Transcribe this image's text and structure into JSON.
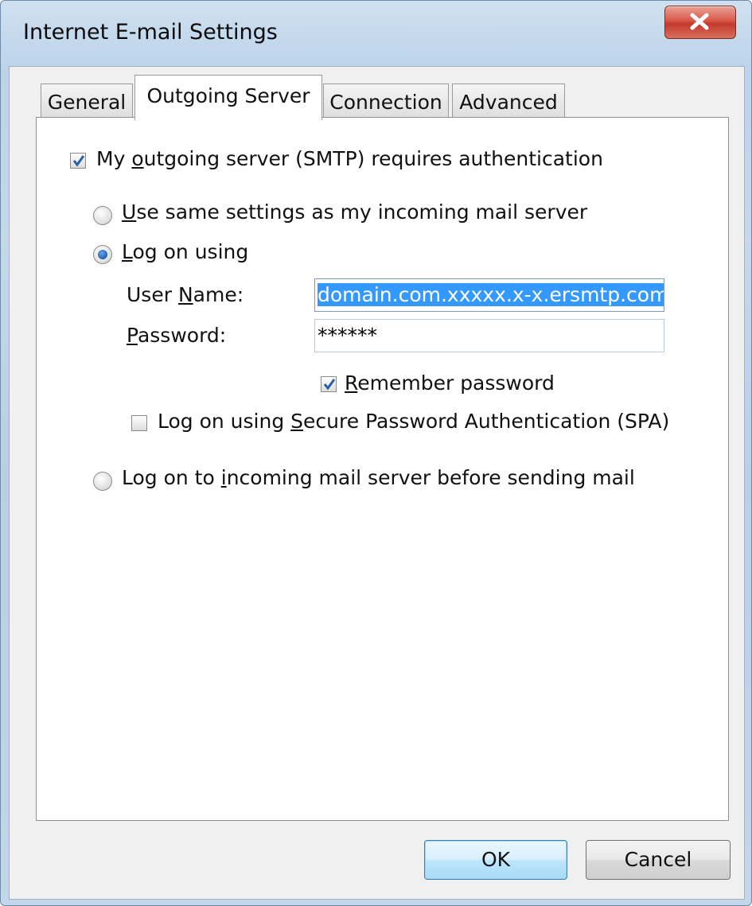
{
  "window": {
    "title": "Internet E-mail Settings"
  },
  "tabs": [
    {
      "label": "General",
      "active": false
    },
    {
      "label": "Outgoing Server",
      "active": true
    },
    {
      "label": "Connection",
      "active": false
    },
    {
      "label": "Advanced",
      "active": false
    }
  ],
  "outgoing": {
    "requires_auth": {
      "pre": "My ",
      "accel": "o",
      "post": "utgoing server (SMTP) requires authentication",
      "checked": true
    },
    "same_settings": {
      "pre": "",
      "accel": "U",
      "post": "se same settings as my incoming mail server",
      "selected": false
    },
    "log_on_using": {
      "pre": "",
      "accel": "L",
      "post": "og on using",
      "selected": true
    },
    "user_name": {
      "pre": "User ",
      "accel": "N",
      "post": "ame:",
      "value": "domain.com.xxxxx.x-x.ersmtp.com"
    },
    "password": {
      "pre": "",
      "accel": "P",
      "post": "assword:",
      "value": "******"
    },
    "remember_password": {
      "pre": "",
      "accel": "R",
      "post": "emember password",
      "checked": true
    },
    "spa": {
      "pre": "Log on using ",
      "accel": "S",
      "post": "ecure Password Authentication (SPA)",
      "checked": false
    },
    "log_on_incoming": {
      "pre": "Log on to ",
      "accel": "i",
      "post": "ncoming mail server before sending mail",
      "selected": false
    }
  },
  "buttons": {
    "ok": "OK",
    "cancel": "Cancel"
  }
}
